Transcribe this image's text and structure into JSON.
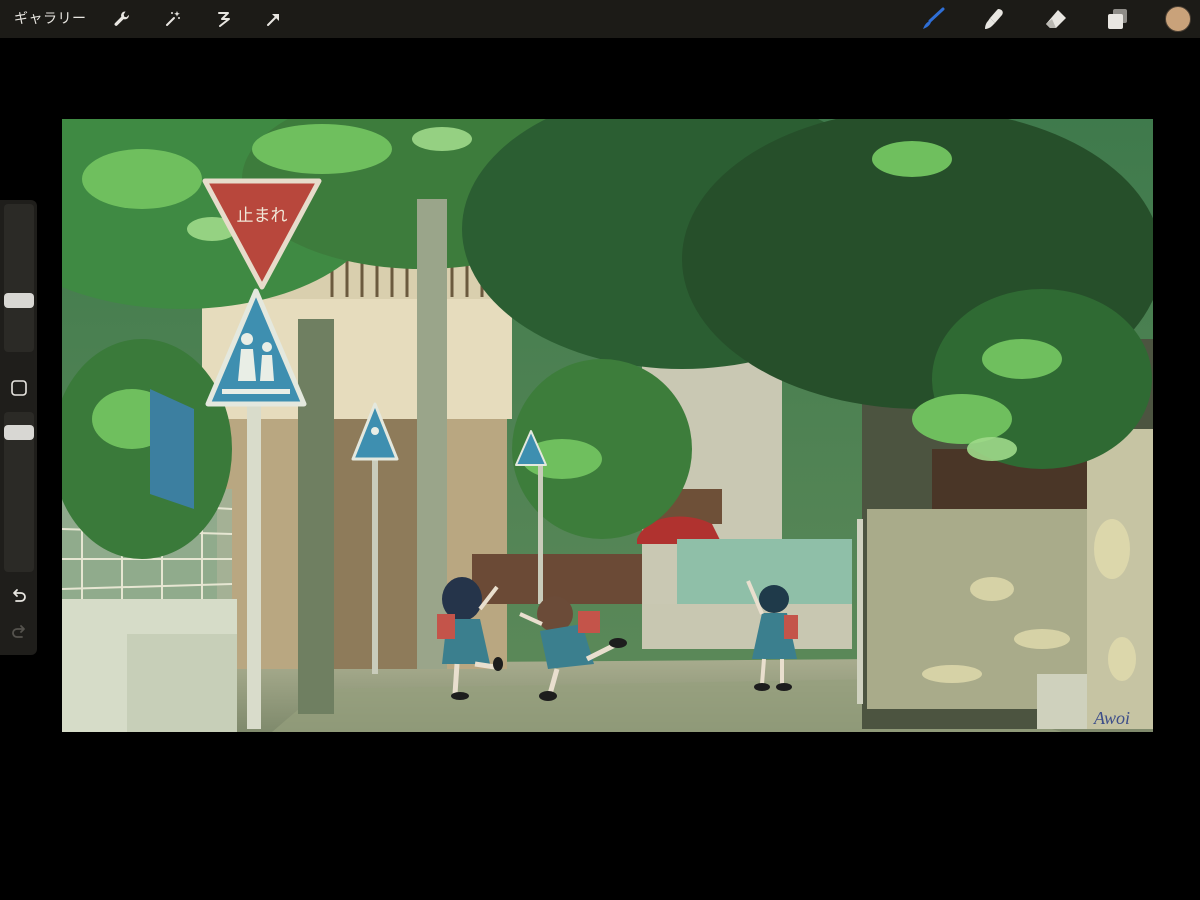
{
  "toolbar": {
    "gallery_label": "ギャラリー",
    "left_tools": [
      "wrench-icon",
      "magic-wand-icon",
      "selection-icon",
      "transform-arrow-icon"
    ],
    "right_tools": [
      "brush-icon",
      "smudge-icon",
      "eraser-icon",
      "layers-icon",
      "color-swatch"
    ],
    "active_tool": "brush-icon",
    "active_color": "#2f6fd6",
    "current_color": "#c9a27a",
    "bar_color": "#1c1b17"
  },
  "sidebar": {
    "controls": [
      "brush-size-slider",
      "modify-square-button",
      "opacity-slider",
      "undo-button",
      "redo-button"
    ],
    "brush_size": 0.55,
    "opacity": 0.9
  },
  "artwork": {
    "signature": "Awoi",
    "sign_text": "止まれ"
  }
}
